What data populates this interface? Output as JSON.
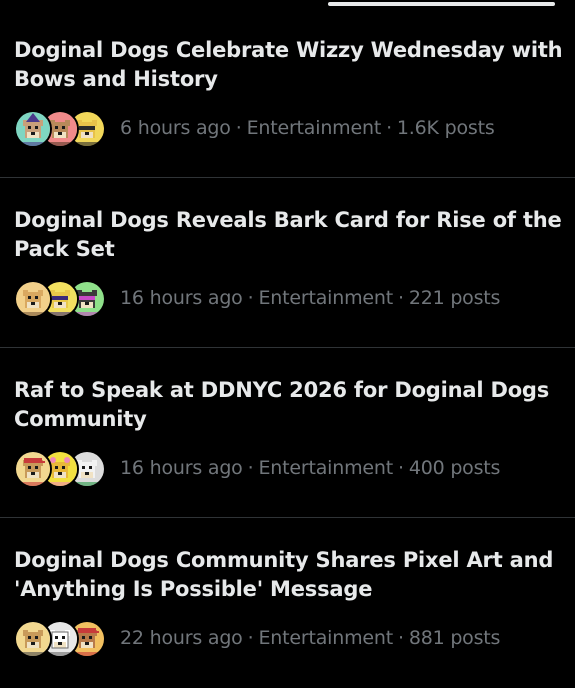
{
  "stories": [
    {
      "title": "Doginal Dogs Celebrate Wizzy Wednesday with Bows and History",
      "time": "6 hours ago",
      "category": "Entertainment",
      "posts": "1.6K posts",
      "avatars": [
        {
          "bg": "#7fd6c2",
          "fur": "#c9a07a",
          "accent": "#4b3a8c",
          "icon": "wizard-dog-avatar-icon"
        },
        {
          "bg": "#f08a8a",
          "fur": "#b88a5a",
          "accent": "#5a3a2a",
          "icon": "dog-avatar-icon"
        },
        {
          "bg": "#f2d85a",
          "fur": "#e8c24a",
          "accent": "#2a2a2a",
          "icon": "sunglasses-dog-avatar-icon"
        }
      ]
    },
    {
      "title": "Doginal Dogs Reveals Bark Card for Rise of the Pack Set",
      "time": "16 hours ago",
      "category": "Entertainment",
      "posts": "221 posts",
      "avatars": [
        {
          "bg": "#f2d08a",
          "fur": "#d9a860",
          "accent": "#7a5a3a",
          "icon": "dog-avatar-icon"
        },
        {
          "bg": "#f2e060",
          "fur": "#e8c84a",
          "accent": "#3a2a7a",
          "icon": "sunglasses-dog-avatar-icon"
        },
        {
          "bg": "#8fe08a",
          "fur": "#3a3a3a",
          "accent": "#c84ac8",
          "icon": "sunglasses-dog-avatar-icon"
        }
      ]
    },
    {
      "title": "Raf to Speak at DDNYC 2026 for Doginal Dogs Community",
      "time": "16 hours ago",
      "category": "Entertainment",
      "posts": "400 posts",
      "avatars": [
        {
          "bg": "#f2d890",
          "fur": "#c89a5a",
          "accent": "#c83a3a",
          "icon": "cap-dog-avatar-icon"
        },
        {
          "bg": "#f2e040",
          "fur": "#e8b83a",
          "accent": "#f08ab8",
          "icon": "flower-dog-avatar-icon"
        },
        {
          "bg": "#dcdcdc",
          "fur": "#f2f2f2",
          "accent": "#2a9a4a",
          "icon": "dog-avatar-icon"
        }
      ]
    },
    {
      "title": "Doginal Dogs Community Shares Pixel Art and 'Anything Is Possible' Message",
      "time": "22 hours ago",
      "category": "Entertainment",
      "posts": "881 posts",
      "avatars": [
        {
          "bg": "#f2d890",
          "fur": "#c89a5a",
          "accent": "#4a4a4a",
          "icon": "dog-avatar-icon"
        },
        {
          "bg": "#e8e8e8",
          "fur": "#ffffff",
          "accent": "#6a6a6a",
          "icon": "sketch-dog-avatar-icon"
        },
        {
          "bg": "#f2c060",
          "fur": "#b87a4a",
          "accent": "#c83a3a",
          "icon": "cap-dog-avatar-icon"
        }
      ]
    }
  ],
  "separator": "·"
}
